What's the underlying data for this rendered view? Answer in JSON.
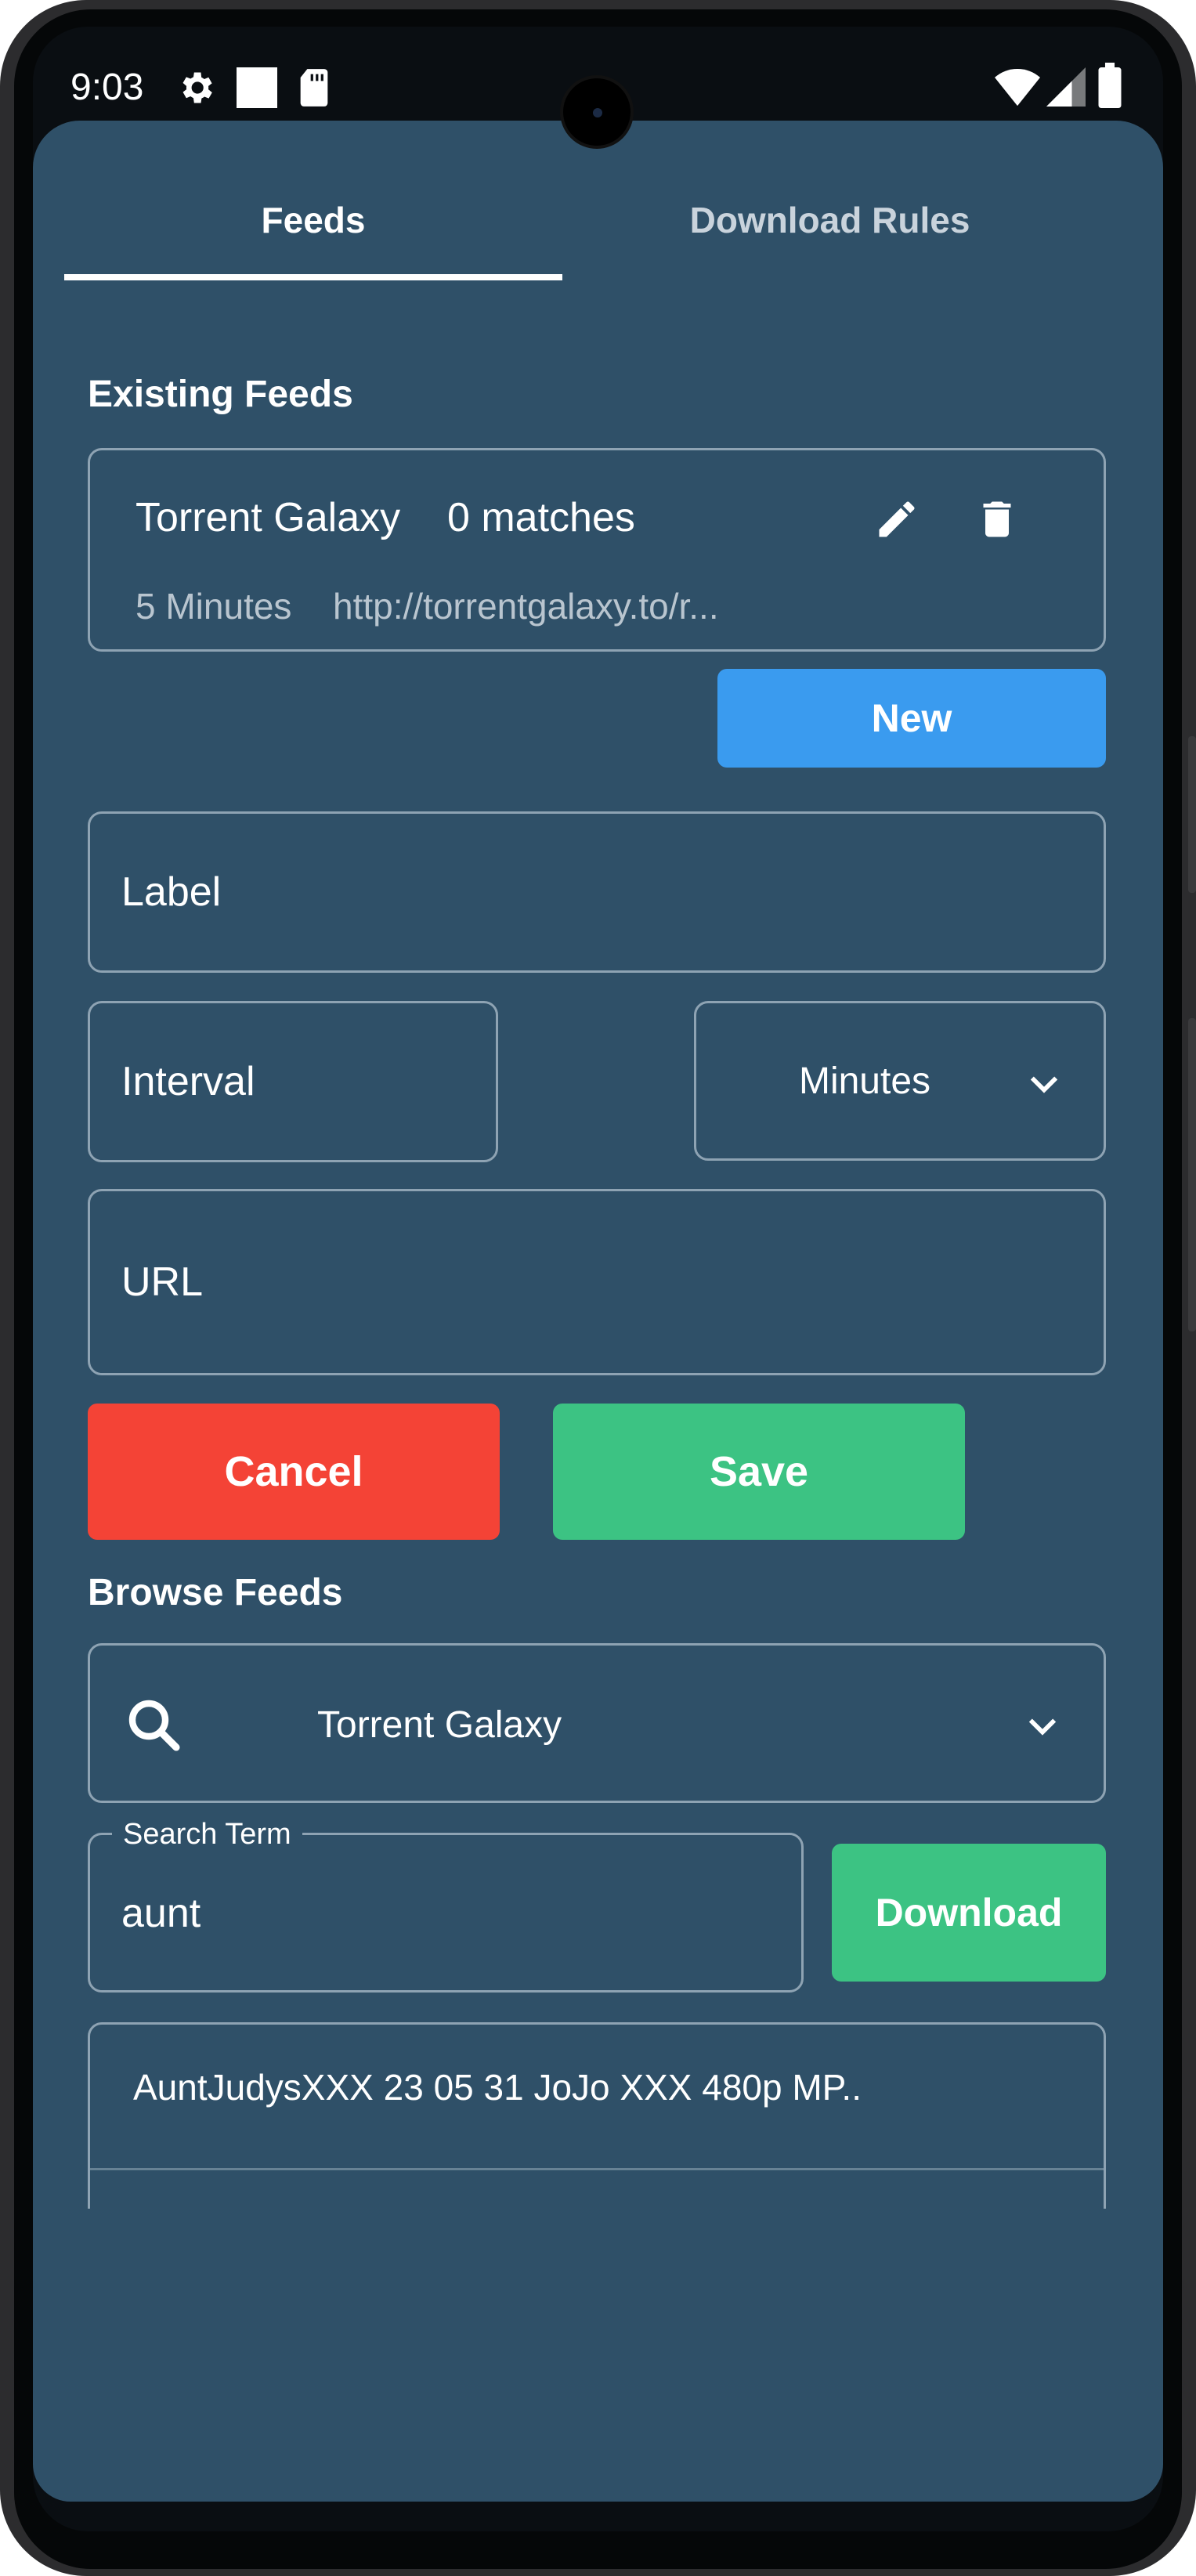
{
  "status_bar": {
    "time": "9:03",
    "icons": [
      "gear-icon",
      "square-icon",
      "sd-card-icon",
      "wifi-icon",
      "signal-icon",
      "battery-icon"
    ]
  },
  "tabs": [
    {
      "label": "Feeds",
      "selected": true
    },
    {
      "label": "Download Rules",
      "selected": false
    }
  ],
  "existing_feeds": {
    "heading": "Existing Feeds",
    "items": [
      {
        "name": "Torrent Galaxy",
        "matches": "0 matches",
        "interval": "5 Minutes",
        "url": "http://torrentgalaxy.to/r..."
      }
    ],
    "new_button": "New"
  },
  "form": {
    "label_placeholder": "Label",
    "interval_placeholder": "Interval",
    "interval_unit": "Minutes",
    "url_placeholder": "URL",
    "cancel_label": "Cancel",
    "save_label": "Save"
  },
  "browse_feeds": {
    "heading": "Browse Feeds",
    "selected_feed": "Torrent Galaxy",
    "search_label": "Search Term",
    "search_value": "aunt",
    "download_label": "Download",
    "results": [
      "AuntJudysXXX 23 05 31 JoJo XXX 480p MP.."
    ]
  },
  "colors": {
    "background": "#2f5068",
    "new_button": "#3a9bef",
    "cancel_button": "#f44336",
    "save_button": "#3cc383",
    "download_button": "#3cc383"
  }
}
